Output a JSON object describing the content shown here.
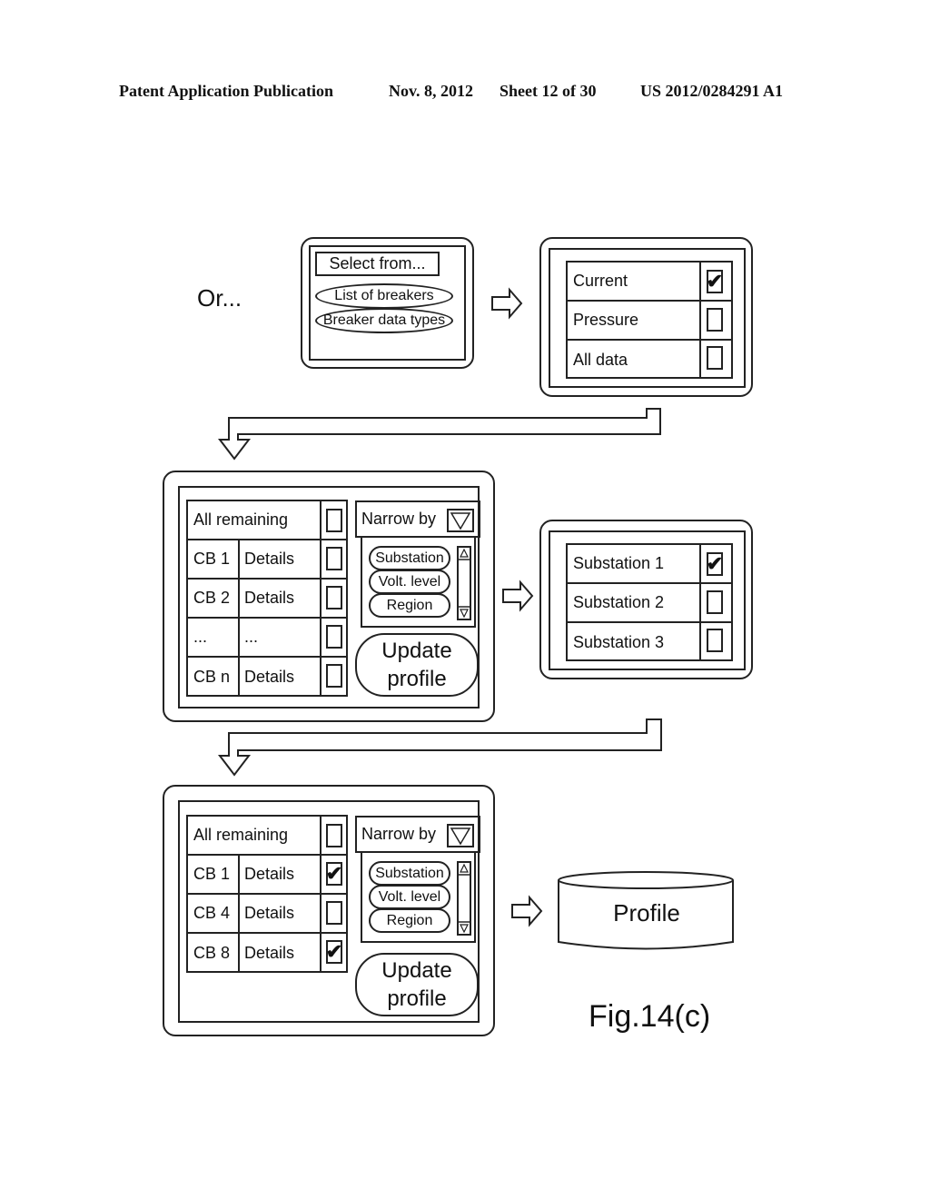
{
  "header": {
    "publication": "Patent Application Publication",
    "date": "Nov. 8, 2012",
    "sheet": "Sheet 12 of 30",
    "number": "US 2012/0284291 A1"
  },
  "or_label": "Or...",
  "select_panel": {
    "title": "Select from...",
    "options": [
      "List of breakers",
      "Breaker data types"
    ]
  },
  "data_types_panel": {
    "rows": [
      {
        "label": "Current",
        "checked": true
      },
      {
        "label": "Pressure",
        "checked": false
      },
      {
        "label": "All data",
        "checked": false
      }
    ]
  },
  "breaker_panel_1": {
    "all_remaining": {
      "label": "All remaining",
      "checked": false
    },
    "rows": [
      {
        "id": "CB 1",
        "details": "Details",
        "checked": false
      },
      {
        "id": "CB 2",
        "details": "Details",
        "checked": false
      },
      {
        "id": "...",
        "details": "...",
        "checked": false
      },
      {
        "id": "CB n",
        "details": "Details",
        "checked": false
      }
    ],
    "narrow_by": {
      "label": "Narrow by",
      "options": [
        "Substation",
        "Volt. level",
        "Region"
      ]
    },
    "update_button": {
      "line1": "Update",
      "line2": "profile"
    }
  },
  "substation_panel": {
    "rows": [
      {
        "label": "Substation 1",
        "checked": true
      },
      {
        "label": "Substation 2",
        "checked": false
      },
      {
        "label": "Substation 3",
        "checked": false
      }
    ]
  },
  "breaker_panel_2": {
    "all_remaining": {
      "label": "All remaining",
      "checked": false
    },
    "rows": [
      {
        "id": "CB 1",
        "details": "Details",
        "checked": true
      },
      {
        "id": "CB 4",
        "details": "Details",
        "checked": false
      },
      {
        "id": "CB 8",
        "details": "Details",
        "checked": true
      }
    ],
    "narrow_by": {
      "label": "Narrow by",
      "options": [
        "Substation",
        "Volt. level",
        "Region"
      ]
    },
    "update_button": {
      "line1": "Update",
      "line2": "profile"
    }
  },
  "profile_db": {
    "label": "Profile"
  },
  "figure_label": "Fig.14(c)",
  "checkmark_glyph": "✔"
}
